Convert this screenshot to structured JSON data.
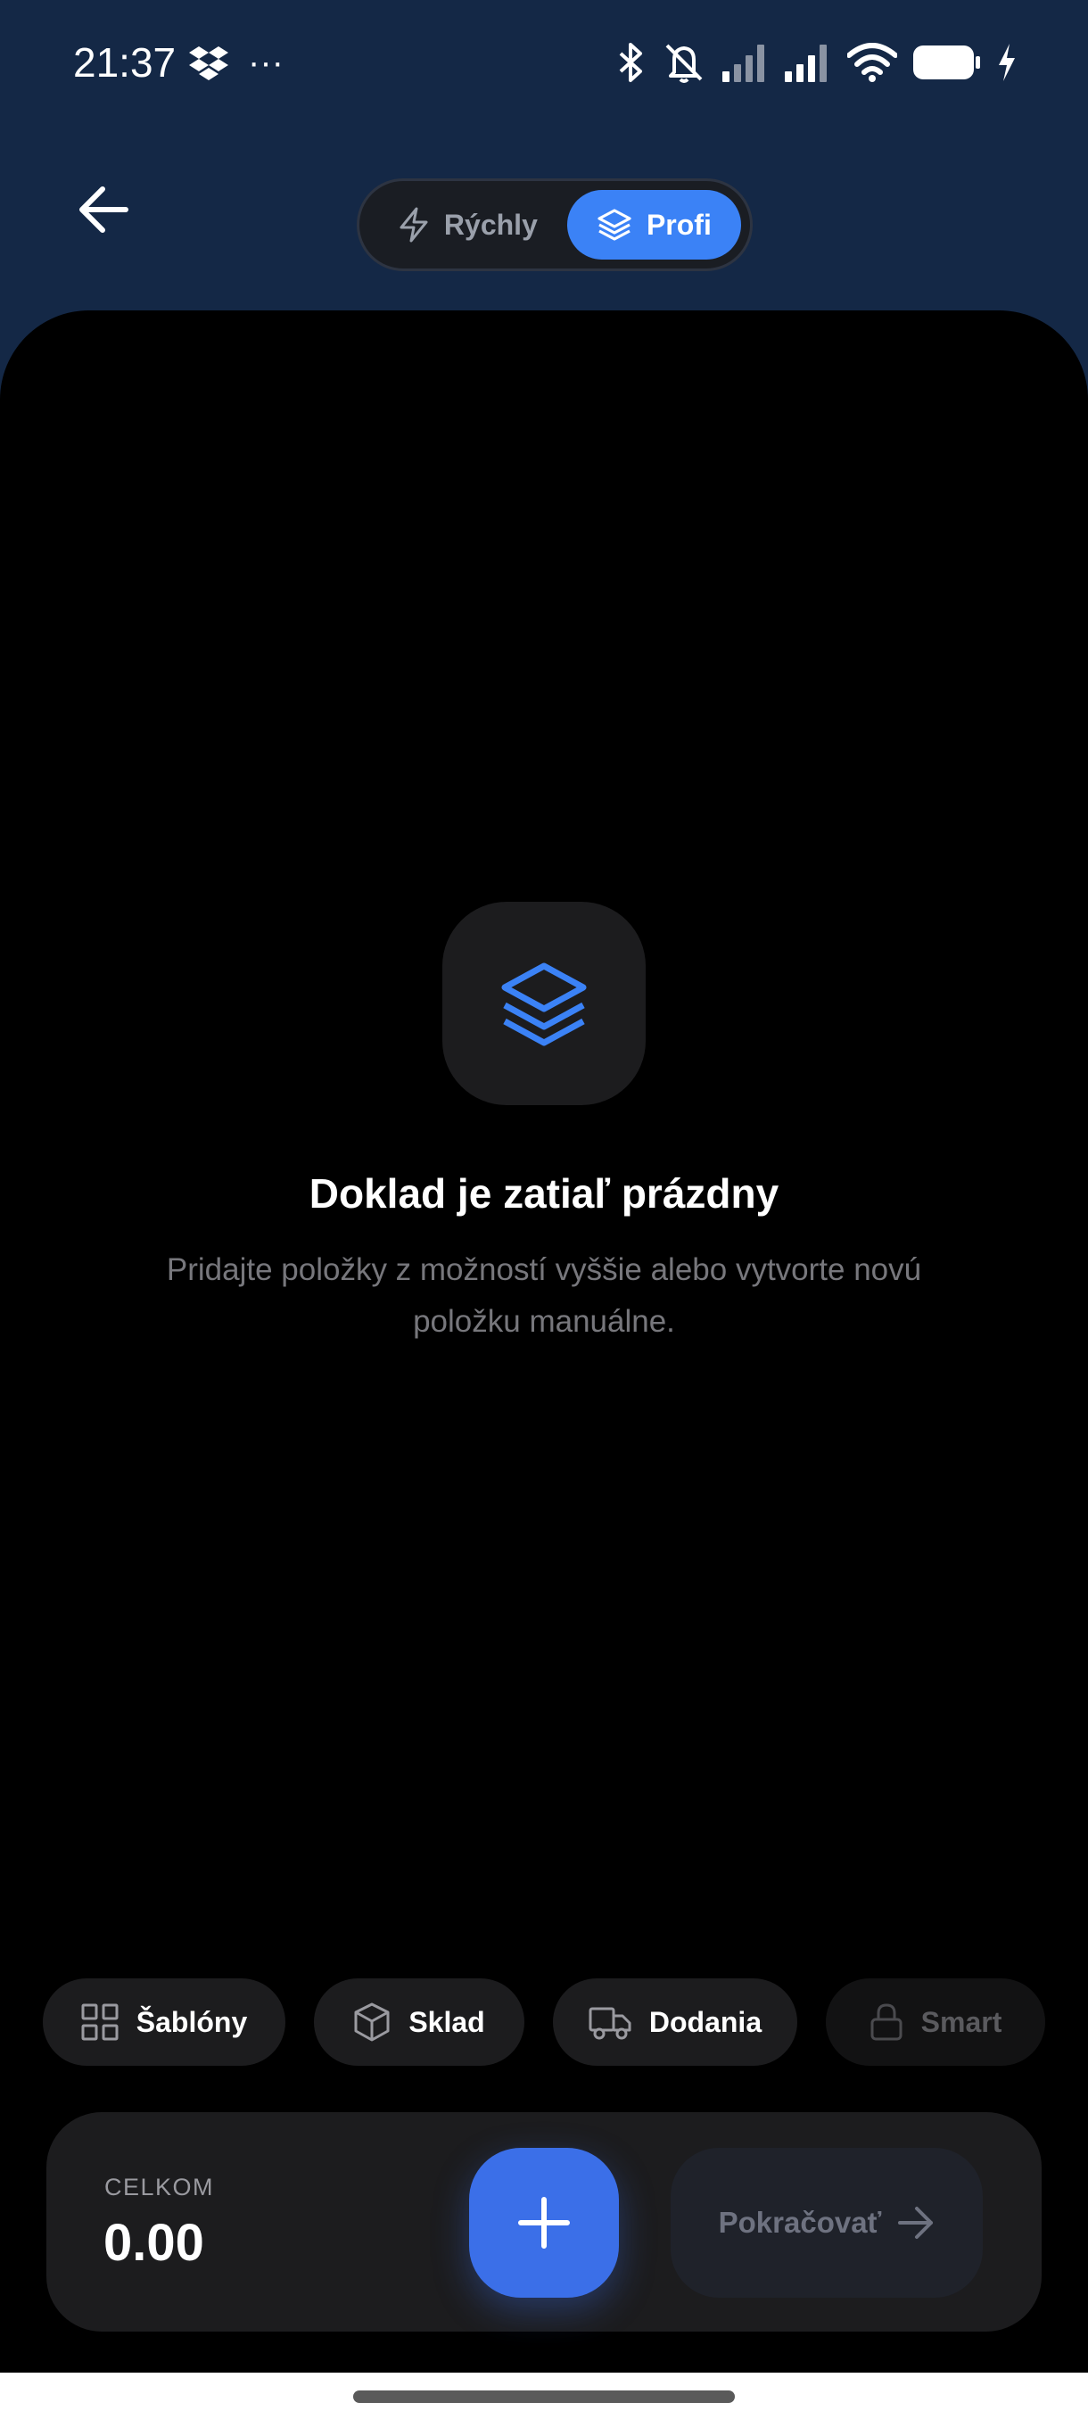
{
  "status_bar": {
    "time": "21:37",
    "more": "···",
    "icons": [
      "dropbox-icon",
      "bluetooth-icon",
      "silent-icon",
      "signal-icon",
      "signal-icon",
      "wifi-icon",
      "battery-icon",
      "charging-icon"
    ]
  },
  "header": {
    "back_icon": "arrow-left-icon",
    "mode_toggle": {
      "quick_label": "Rýchly",
      "quick_icon": "lightning-icon",
      "pro_label": "Profi",
      "pro_icon": "layers-icon",
      "selected": "Profi"
    }
  },
  "empty_state": {
    "icon": "layers-icon",
    "title": "Doklad je zatiaľ prázdny",
    "subtitle": "Pridajte položky z možností vyššie alebo vytvorte novú položku manuálne."
  },
  "chips": [
    {
      "label": "Šablóny",
      "icon": "grid-icon",
      "enabled": true
    },
    {
      "label": "Sklad",
      "icon": "box-icon",
      "enabled": true
    },
    {
      "label": "Dodania",
      "icon": "truck-icon",
      "enabled": true
    },
    {
      "label": "Smart",
      "icon": "lock-icon",
      "enabled": false
    }
  ],
  "bottom_bar": {
    "total_label": "CELKOM",
    "total_value": "0.00",
    "add_icon": "plus-icon",
    "continue_label": "Pokračovať",
    "continue_icon": "arrow-right-icon"
  },
  "colors": {
    "header_bg": "#142846",
    "accent": "#3b82f6",
    "sheet_bg": "#000000",
    "card_bg": "#1c1c1e"
  }
}
